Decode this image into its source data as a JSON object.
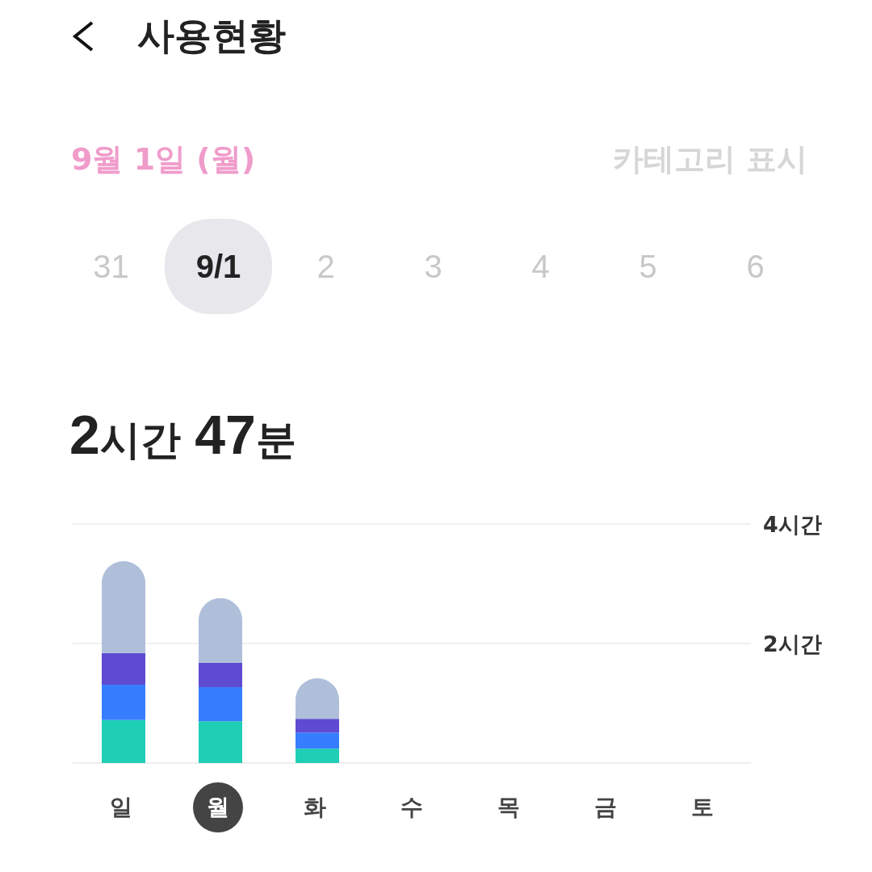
{
  "header": {
    "title": "사용현황"
  },
  "date_row": {
    "date": "9월 1일 (월)",
    "category_toggle": "카테고리 표시"
  },
  "week_dates": [
    {
      "label": "31",
      "selected": false
    },
    {
      "label": "9/1",
      "selected": true
    },
    {
      "label": "2",
      "selected": false
    },
    {
      "label": "3",
      "selected": false
    },
    {
      "label": "4",
      "selected": false
    },
    {
      "label": "5",
      "selected": false
    },
    {
      "label": "6",
      "selected": false
    }
  ],
  "total": "2시간 47분",
  "chart": {
    "chart_data": {
      "type": "bar",
      "stacked": true,
      "ylim": [
        0,
        4
      ],
      "yticks": [
        {
          "value": 2,
          "label": "2시간"
        },
        {
          "value": 4,
          "label": "4시간"
        }
      ],
      "series": [
        {
          "color": "#1ecfb5",
          "values": [
            0.72,
            0.7,
            0.24,
            0,
            0,
            0,
            0
          ]
        },
        {
          "color": "#377dff",
          "values": [
            0.59,
            0.57,
            0.27,
            0,
            0,
            0,
            0
          ]
        },
        {
          "color": "#5e4bd1",
          "values": [
            0.53,
            0.41,
            0.23,
            0,
            0,
            0,
            0
          ]
        },
        {
          "color": "#afbfda",
          "values": [
            1.54,
            1.08,
            0.68,
            0,
            0,
            0,
            0
          ]
        }
      ]
    },
    "day_labels": [
      {
        "label": "일",
        "selected": false
      },
      {
        "label": "월",
        "selected": true
      },
      {
        "label": "화",
        "selected": false
      },
      {
        "label": "수",
        "selected": false
      },
      {
        "label": "목",
        "selected": false
      },
      {
        "label": "금",
        "selected": false
      },
      {
        "label": "토",
        "selected": false
      }
    ]
  }
}
